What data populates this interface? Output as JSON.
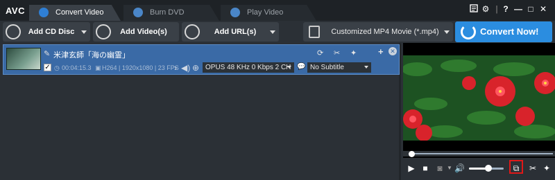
{
  "app": {
    "logo": "AVC"
  },
  "tabs": [
    {
      "label": "Convert Video",
      "icon": "convert-icon"
    },
    {
      "label": "Burn DVD",
      "icon": "disc-icon"
    },
    {
      "label": "Play Video",
      "icon": "play-icon"
    }
  ],
  "window_controls": {
    "help": "?",
    "minimize": "—",
    "maximize": "□",
    "close": "✕"
  },
  "toolbar": {
    "add_cd": "Add CD Disc",
    "add_video": "Add Video(s)",
    "add_url": "Add URL(s)",
    "format": "Customized MP4 Movie (*.mp4)",
    "convert": "Convert Now!"
  },
  "item": {
    "name": "米津玄師「海の幽霊」",
    "duration": "00:04:15.3",
    "video_info": "H264 | 1920x1080 | 23 FPS",
    "audio": "OPUS 48 KHz 0 Kbps 2 CH",
    "subtitle": "No Subtitle",
    "checked": true
  },
  "player": {
    "seek_progress": 0.02,
    "volume": 0.55
  },
  "colors": {
    "accent": "#2b8de0",
    "selected_row": "#3a6aa6",
    "highlight": "#e01818"
  }
}
